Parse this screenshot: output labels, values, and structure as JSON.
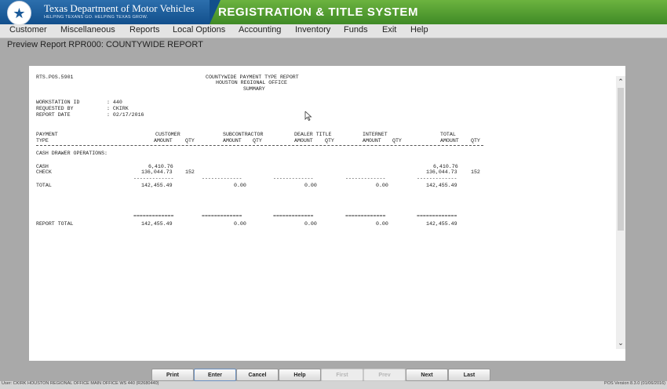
{
  "app": {
    "brand_name": "Texas Department of Motor Vehicles",
    "brand_tagline": "HELPING TEXANS GO. HELPING TEXAS GROW.",
    "system_title": "REGISTRATION & TITLE SYSTEM"
  },
  "menu": [
    "Customer",
    "Miscellaneous",
    "Reports",
    "Local Options",
    "Accounting",
    "Inventory",
    "Funds",
    "Exit",
    "Help"
  ],
  "preview_title": "Preview Report RPR000: COUNTYWIDE REPORT",
  "report": {
    "id": "RTS.POS.5901",
    "title_lines": [
      "COUNTYWIDE PAYMENT TYPE REPORT",
      "HOUSTON REGIONAL OFFICE",
      "SUMMARY"
    ],
    "info": [
      {
        "label": "WORKSTATION ID",
        "value": ": 440"
      },
      {
        "label": "REQUESTED BY",
        "value": ": CKIRK"
      },
      {
        "label": "REPORT DATE",
        "value": ": 02/17/2016"
      }
    ],
    "headers": {
      "payment": "PAYMENT",
      "type": "TYPE",
      "customer": "CUSTOMER",
      "subcontractor": "SUBCONTRACTOR",
      "dealer_title": "DEALER TITLE",
      "internet": "INTERNET",
      "total": "TOTAL",
      "amount": "AMOUNT",
      "qty": "QTY"
    },
    "section_label": "CASH DRAWER OPERATIONS:",
    "rows": [
      {
        "type": "CASH",
        "customer_amount": "6,410.76",
        "customer_qty": "",
        "total_amount": "6,410.76",
        "total_qty": ""
      },
      {
        "type": "CHECK",
        "customer_amount": "136,044.73",
        "customer_qty": "152",
        "total_amount": "136,044.73",
        "total_qty": "152"
      }
    ],
    "total_row": {
      "label": "TOTAL",
      "customer": "142,455.49",
      "subcontractor": "0.00",
      "dealer": "0.00",
      "internet": "0.00",
      "total": "142,455.49"
    },
    "report_total_row": {
      "label": "REPORT TOTAL",
      "customer": "142,455.49",
      "subcontractor": "0.00",
      "dealer": "0.00",
      "internet": "0.00",
      "total": "142,455.49"
    },
    "single_rule": "-------------",
    "double_rule": "============="
  },
  "buttons": [
    {
      "label": "Print",
      "enabled": true
    },
    {
      "label": "Enter",
      "enabled": true
    },
    {
      "label": "Cancel",
      "enabled": true
    },
    {
      "label": "Help",
      "enabled": true
    },
    {
      "label": "First",
      "enabled": false
    },
    {
      "label": "Prev",
      "enabled": false
    },
    {
      "label": "Next",
      "enabled": true
    },
    {
      "label": "Last",
      "enabled": true
    }
  ],
  "status": {
    "left": "User: CKIRK  HOUSTON REGIONAL OFFICE  MAIN OFFICE  WS 440 (R2680440)",
    "right": "POS Version 8.3.0 (01/06/2016)"
  },
  "icons": {
    "seal": "texas-star-seal-icon",
    "scroll_up": "chevron-up-icon",
    "scroll_down": "chevron-down-icon",
    "cursor": "mouse-cursor-icon"
  },
  "colors": {
    "header_green": "#6cb33f",
    "header_blue": "#124f8c",
    "background": "#a9a9a9"
  }
}
